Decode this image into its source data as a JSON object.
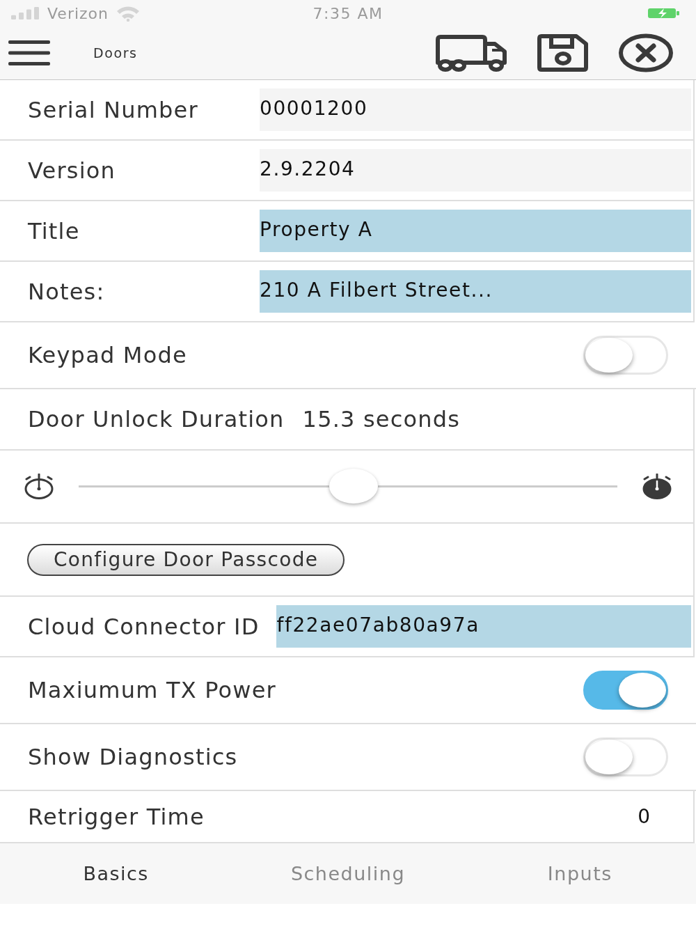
{
  "status_bar": {
    "carrier": "Verizon",
    "time": "7:35 AM"
  },
  "header": {
    "title": "Doors"
  },
  "rows": [
    {
      "kind": "field",
      "label": "Serial Number",
      "value": "00001200",
      "editable": false
    },
    {
      "kind": "field",
      "label": "Version",
      "value": "2.9.2204",
      "editable": false
    },
    {
      "kind": "field",
      "label": "Title",
      "value": "Property A",
      "editable": true
    },
    {
      "kind": "field",
      "label": "Notes:",
      "value": "210 A Filbert Street...",
      "editable": true
    },
    {
      "kind": "toggle",
      "label": "Keypad Mode",
      "on": false
    },
    {
      "kind": "reading",
      "label": "Door Unlock Duration",
      "value": "15.3 seconds"
    },
    {
      "kind": "slider",
      "level": 0.51
    },
    {
      "kind": "button",
      "label": "Configure Door Passcode"
    },
    {
      "kind": "field",
      "label": "Cloud Connector ID",
      "value": "ff22ae07ab80a97a",
      "editable": true
    },
    {
      "kind": "toggle",
      "label": "Maxiumum TX Power",
      "on": true
    },
    {
      "kind": "toggle",
      "label": "Show Diagnostics",
      "on": false
    },
    {
      "kind": "number",
      "label": "Retrigger Time",
      "value": "0"
    }
  ],
  "tabs": [
    {
      "label": "Basics",
      "selected": true
    },
    {
      "label": "Scheduling",
      "selected": false
    },
    {
      "label": "Inputs",
      "selected": false
    }
  ]
}
